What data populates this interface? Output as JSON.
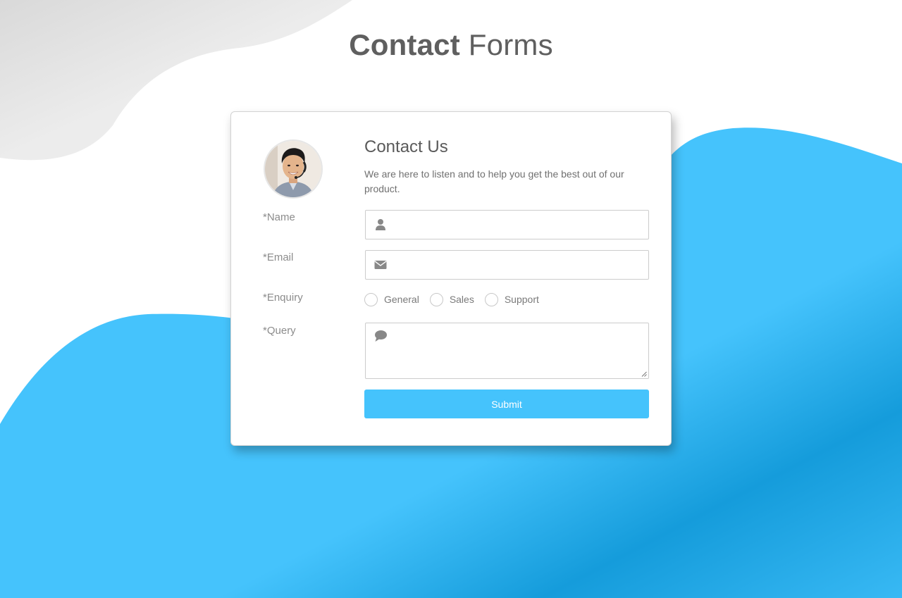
{
  "page": {
    "title_bold": "Contact",
    "title_light": "Forms"
  },
  "colors": {
    "accent_blue": "#45c3fc",
    "blob_gray": "#ececec",
    "text_gray": "#5f5f5f"
  },
  "card": {
    "avatar_alt": "support agent",
    "heading": "Contact Us",
    "description": "We are here to listen and to help you get the best out of our product.",
    "fields": {
      "name_label": "*Name",
      "name_icon": "user-icon",
      "name_value": "",
      "email_label": "*Email",
      "email_icon": "envelope-icon",
      "email_value": "",
      "enquiry_label": "*Enquiry",
      "enquiry_options": [
        "General",
        "Sales",
        "Support"
      ],
      "query_label": "*Query",
      "query_icon": "comment-icon",
      "query_value": ""
    },
    "submit_label": "Submit"
  }
}
